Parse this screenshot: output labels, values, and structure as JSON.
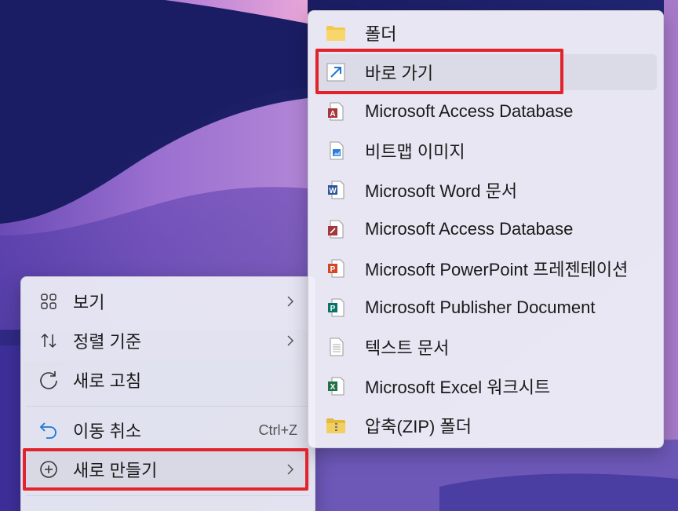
{
  "colors": {
    "highlight_box": "#e3232b",
    "accent_blue": "#1a78d6",
    "wallpaper_deep": "#161a5e",
    "wallpaper_violet": "#8c63c9"
  },
  "context_menu": {
    "items": [
      {
        "label": "보기",
        "icon": "grid-icon",
        "has_submenu": true
      },
      {
        "label": "정렬 기준",
        "icon": "sort-icon",
        "has_submenu": true
      },
      {
        "label": "새로 고침",
        "icon": "refresh-icon",
        "has_submenu": false
      },
      {
        "label": "이동 취소",
        "icon": "undo-icon",
        "shortcut": "Ctrl+Z"
      },
      {
        "label": "새로 만들기",
        "icon": "add-circle-icon",
        "has_submenu": true
      }
    ]
  },
  "new_submenu": {
    "items": [
      {
        "label": "폴더",
        "icon": "folder-icon"
      },
      {
        "label": "바로 가기",
        "icon": "shortcut-icon"
      },
      {
        "label": "Microsoft Access Database",
        "icon": "access-file-icon"
      },
      {
        "label": "비트맵 이미지",
        "icon": "bitmap-file-icon"
      },
      {
        "label": "Microsoft Word 문서",
        "icon": "word-file-icon"
      },
      {
        "label": "Microsoft Access Database",
        "icon": "access-file-icon"
      },
      {
        "label": "Microsoft PowerPoint 프레젠테이션",
        "icon": "powerpoint-file-icon"
      },
      {
        "label": "Microsoft Publisher Document",
        "icon": "publisher-file-icon"
      },
      {
        "label": "텍스트 문서",
        "icon": "text-file-icon"
      },
      {
        "label": "Microsoft Excel 워크시트",
        "icon": "excel-file-icon"
      },
      {
        "label": "압축(ZIP) 폴더",
        "icon": "zip-folder-icon"
      }
    ]
  }
}
